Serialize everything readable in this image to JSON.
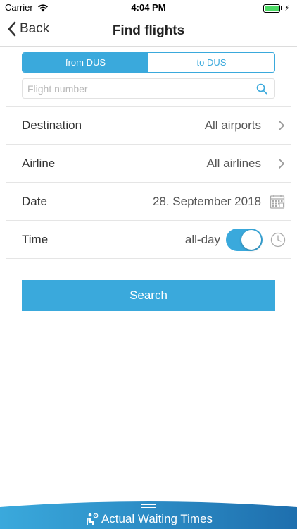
{
  "status_bar": {
    "carrier": "Carrier",
    "time": "4:04 PM"
  },
  "nav": {
    "back_label": "Back",
    "title": "Find flights"
  },
  "segmented": {
    "options": [
      "from DUS",
      "to DUS"
    ],
    "selected": "from DUS"
  },
  "search": {
    "placeholder": "Flight number",
    "value": ""
  },
  "rows": {
    "destination": {
      "label": "Destination",
      "value": "All airports"
    },
    "airline": {
      "label": "Airline",
      "value": "All airlines"
    },
    "date": {
      "label": "Date",
      "value": "28. September 2018"
    },
    "time": {
      "label": "Time",
      "value": "all-day",
      "toggle_on": true
    }
  },
  "search_button": {
    "label": "Search"
  },
  "bottom_bar": {
    "label": "Actual Waiting Times"
  },
  "colors": {
    "accent": "#3aa9dc",
    "battery": "#4cd964",
    "bottom_gradient_start": "#3aa9dc",
    "bottom_gradient_end": "#1e6fae"
  },
  "icons": [
    "wifi-icon",
    "battery-icon",
    "back-chevron-icon",
    "search-icon",
    "chevron-right-icon",
    "calendar-icon",
    "clock-icon",
    "waiting-person-icon"
  ]
}
